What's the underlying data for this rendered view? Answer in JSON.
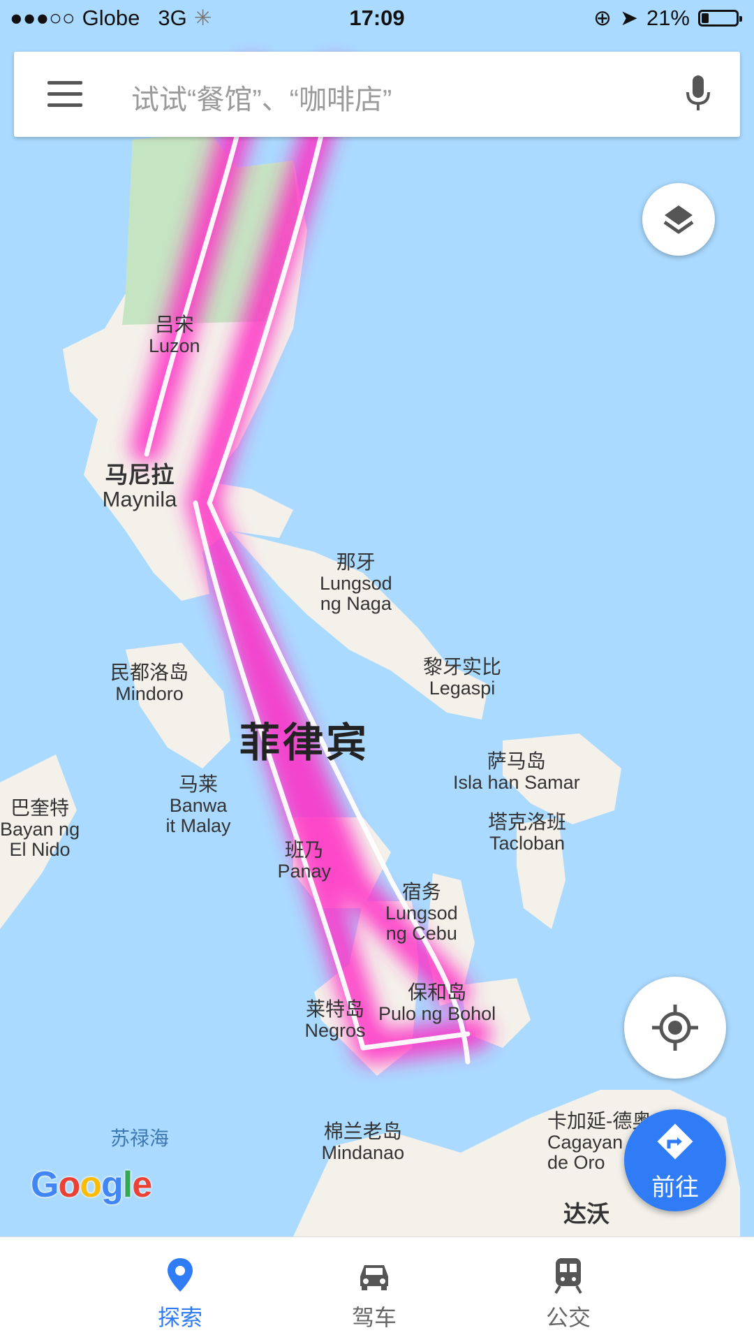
{
  "status_bar": {
    "signal": "●●●○○",
    "carrier": "Globe",
    "network": "3G",
    "time": "17:09",
    "battery": "21%"
  },
  "search": {
    "placeholder": "试试“餐馆”、“咖啡店”"
  },
  "map_labels": {
    "luzon": {
      "zh": "吕宋",
      "en": "Luzon"
    },
    "manila": {
      "zh": "马尼拉",
      "en": "Maynila"
    },
    "naga": {
      "zh": "那牙",
      "en1": "Lungsod",
      "en2": "ng Naga"
    },
    "legaspi": {
      "zh": "黎牙实比",
      "en": "Legaspi"
    },
    "mindoro": {
      "zh": "民都洛岛",
      "en": "Mindoro"
    },
    "country": "菲律宾",
    "samar": {
      "zh": "萨马岛",
      "en": "Isla han Samar"
    },
    "malay": {
      "zh": "马莱",
      "en1": "Banwa",
      "en2": "it Malay"
    },
    "tacloban": {
      "zh": "塔克洛班",
      "en": "Tacloban"
    },
    "el_nido": {
      "zh": "巴奎特",
      "en1": "Bayan ng",
      "en2": "El Nido"
    },
    "panay": {
      "zh": "班乃",
      "en": "Panay"
    },
    "cebu": {
      "zh": "宿务",
      "en1": "Lungsod",
      "en2": "ng Cebu"
    },
    "bohol": {
      "zh": "保和岛",
      "en": "Pulo ng Bohol"
    },
    "negros": {
      "zh": "莱特岛",
      "en": "Negros"
    },
    "sulu_sea": "苏禄海",
    "mindanao": {
      "zh": "棉兰老岛",
      "en": "Mindanao"
    },
    "cagayan": {
      "zh": "卡加延-德奥",
      "en1": "Cagayan",
      "en2": "de Oro"
    },
    "davao": {
      "zh": "达沃"
    }
  },
  "brand": "Google",
  "buttons": {
    "go_label": "前往"
  },
  "bottom_nav": [
    {
      "label": "探索",
      "icon": "map-pin-icon",
      "active": true
    },
    {
      "label": "驾车",
      "icon": "car-icon",
      "active": false
    },
    {
      "label": "公交",
      "icon": "train-icon",
      "active": false
    }
  ],
  "colors": {
    "water": "#aadaff",
    "land": "#f4f1ea",
    "forest": "#c5e4c1",
    "route": "#ff2cc4",
    "accent": "#2f7cf6"
  }
}
